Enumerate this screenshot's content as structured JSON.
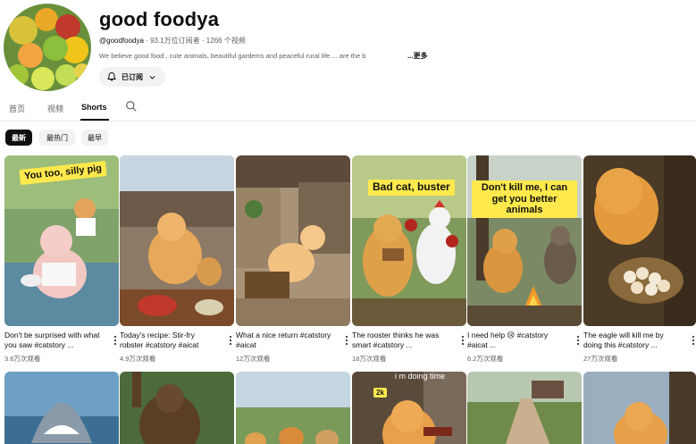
{
  "channel": {
    "name": "good foodya",
    "handle": "@goodfoodya",
    "subscribers": "93.1万位订阅者",
    "videos": "1266 个视频",
    "separator": "·",
    "description": "We believe good food , cute animals, beautiful gardems and peaceful rural life.... are the b",
    "more_label": "...更多",
    "subscribe_label": "已订阅"
  },
  "tabs": [
    {
      "label": "首页"
    },
    {
      "label": "视频"
    },
    {
      "label": "Shorts",
      "active": true
    }
  ],
  "chips": [
    {
      "label": "最新",
      "active": true
    },
    {
      "label": "最热门"
    },
    {
      "label": "最早"
    }
  ],
  "shorts": [
    {
      "title": "Don't be surprised with what you saw #catstory ...",
      "views": "3.6万次观看",
      "caption": "You too, silly pig"
    },
    {
      "title": "Today's recipe: Stir-fry robster #catstory #aicat",
      "views": "4.9万次观看",
      "caption": ""
    },
    {
      "title": "What a nice return #catstory #aicat",
      "views": "12万次观看",
      "caption": ""
    },
    {
      "title": "The rooster thinks he was smart #catstory ...",
      "views": "18万次观看",
      "caption": "Bad cat, buster"
    },
    {
      "title": "I need help 😢 #catstory #aicat ...",
      "views": "6.2万次观看",
      "caption": "Don't kill me, I can get you better animals"
    },
    {
      "title": "The eagle will kill me by doing this #catstory ...",
      "views": "27万次观看",
      "caption": ""
    }
  ],
  "row2": {
    "mini_caption": "i m doing time",
    "price_tag": "2k"
  },
  "colors": {
    "caption_yellow": "#ffe94d",
    "chip_active": "#0f0f0f",
    "chip_inactive": "#f2f2f2"
  }
}
